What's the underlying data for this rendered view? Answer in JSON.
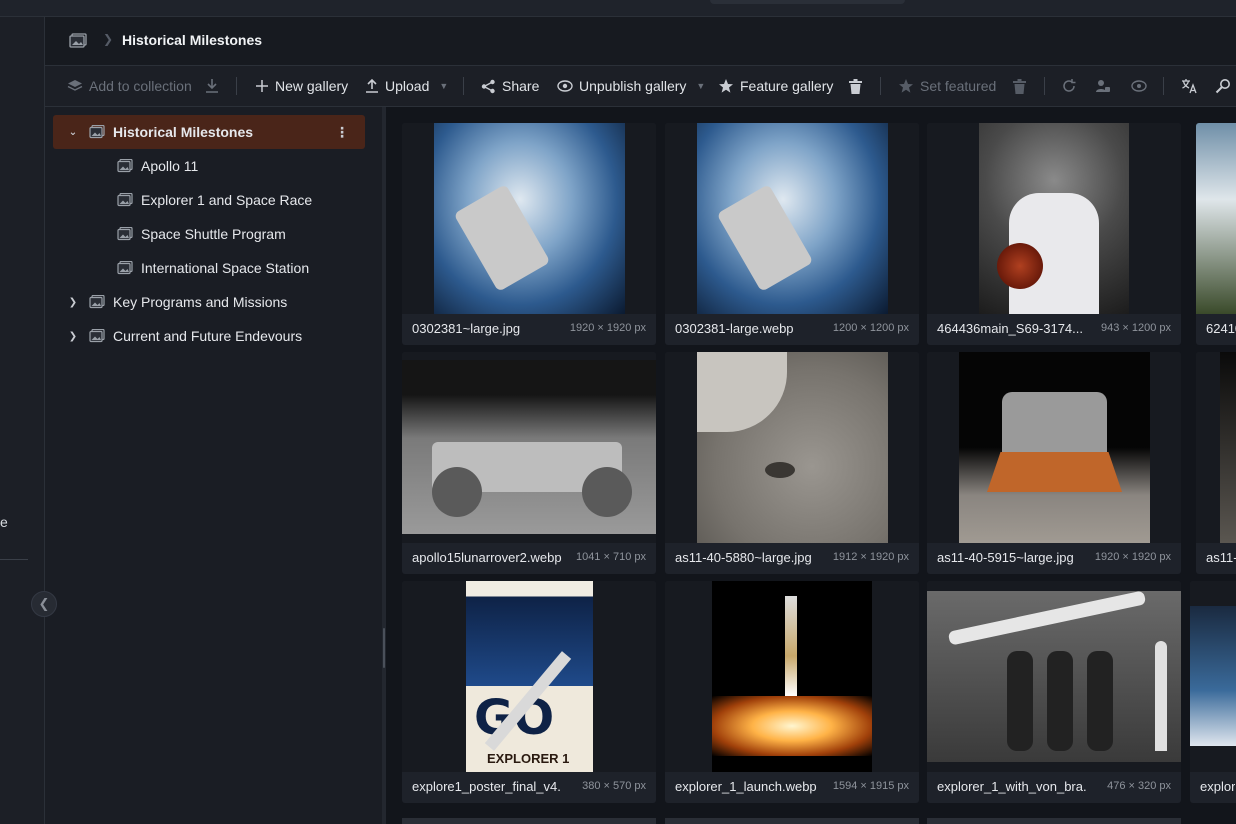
{
  "header": {
    "title": "Historical Milestones"
  },
  "toolbar": {
    "add_to_collection": "Add to collection",
    "new_gallery": "New gallery",
    "upload": "Upload",
    "share": "Share",
    "unpublish_gallery": "Unpublish gallery",
    "feature_gallery": "Feature gallery",
    "set_featured": "Set featured"
  },
  "left_rail": {
    "fragment": "e"
  },
  "tree": {
    "items": [
      {
        "label": "Historical Milestones",
        "expanded": true,
        "selected": true
      },
      {
        "label": "Apollo 11"
      },
      {
        "label": "Explorer 1 and Space Race"
      },
      {
        "label": "Space Shuttle Program"
      },
      {
        "label": "International Space Station"
      },
      {
        "label": "Key Programs and Missions",
        "expanded": false
      },
      {
        "label": "Current and Future Endevours",
        "expanded": false
      }
    ]
  },
  "images": [
    {
      "name": "0302381~large.jpg",
      "dims": "1920 × 1920 px"
    },
    {
      "name": "0302381-large.webp",
      "dims": "1200 × 1200 px"
    },
    {
      "name": "464436main_S69-3174...",
      "dims": "943 × 1200 px"
    },
    {
      "name": "62410"
    },
    {
      "name": "apollo15lunarrover2.webp",
      "dims": "1041 × 710 px"
    },
    {
      "name": "as11-40-5880~large.jpg",
      "dims": "1912 × 1920 px"
    },
    {
      "name": "as11-40-5915~large.jpg",
      "dims": "1920 × 1920 px"
    },
    {
      "name": "as11-4"
    },
    {
      "name": "explore1_poster_final_v4...",
      "dims": "380 × 570 px"
    },
    {
      "name": "explorer_1_launch.webp",
      "dims": "1594 × 1915 px"
    },
    {
      "name": "explorer_1_with_von_bra...",
      "dims": "476 × 320 px"
    },
    {
      "name": "explor"
    }
  ],
  "colors": {
    "selected_bg": "#4a2519",
    "panel_bg": "#1a1d24",
    "grid_bg": "#12151b",
    "card_bg": "#1e222a"
  }
}
